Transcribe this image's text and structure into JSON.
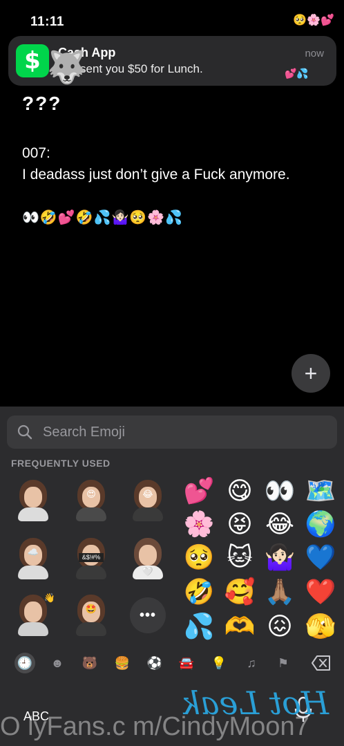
{
  "status_bar": {
    "time": "11:11",
    "overlay_emojis": "🥺🌸💕"
  },
  "notification": {
    "app_name": "Cash App",
    "body": "sent you $50 for Lunch.",
    "time": "now",
    "app_icon": "$",
    "sticker_emoji": "🐺",
    "overlay_emojis": "💕💦"
  },
  "conversation": {
    "question": "???",
    "sender": "007:",
    "message": "I deadass just don’t give a Fuck anymore.",
    "emoji_line": "👀🤣💕🤣💦🤷🏻‍♀️🥺🌸💦"
  },
  "add_button": {
    "label": "+"
  },
  "keyboard": {
    "search_placeholder": "Search Emoji",
    "section_label": "FREQUENTLY USED",
    "stickers": [
      {
        "accent": ""
      },
      {
        "accent": "😍"
      },
      {
        "accent": "😂"
      },
      {
        "accent": "☁️"
      },
      {
        "accent": "&$!#%"
      },
      {
        "accent": "🤍"
      },
      {
        "accent": "👋"
      },
      {
        "accent": "🤩"
      }
    ],
    "more_label": "•••",
    "emoji_grid": [
      [
        "💕",
        "😋",
        "👀",
        "🗺️"
      ],
      [
        "🌸",
        "😝",
        "😂",
        "🌍"
      ],
      [
        "🥺",
        "🐱",
        "🤷🏻‍♀️",
        "💙"
      ],
      [
        "🤣",
        "🥰",
        "🙏🏽",
        "❤️"
      ],
      [
        "💦",
        "🫶",
        "😖",
        "🫣"
      ]
    ],
    "category_icons": [
      "🕘",
      "☻",
      "🐻",
      "🍔",
      "⚽",
      "🚘",
      "💡",
      "♫",
      "⚑"
    ],
    "abc_label": "ABC"
  },
  "watermark": {
    "text": "O lyFans.c m/CindyMoon7",
    "logo_text": "Hot Leak"
  }
}
